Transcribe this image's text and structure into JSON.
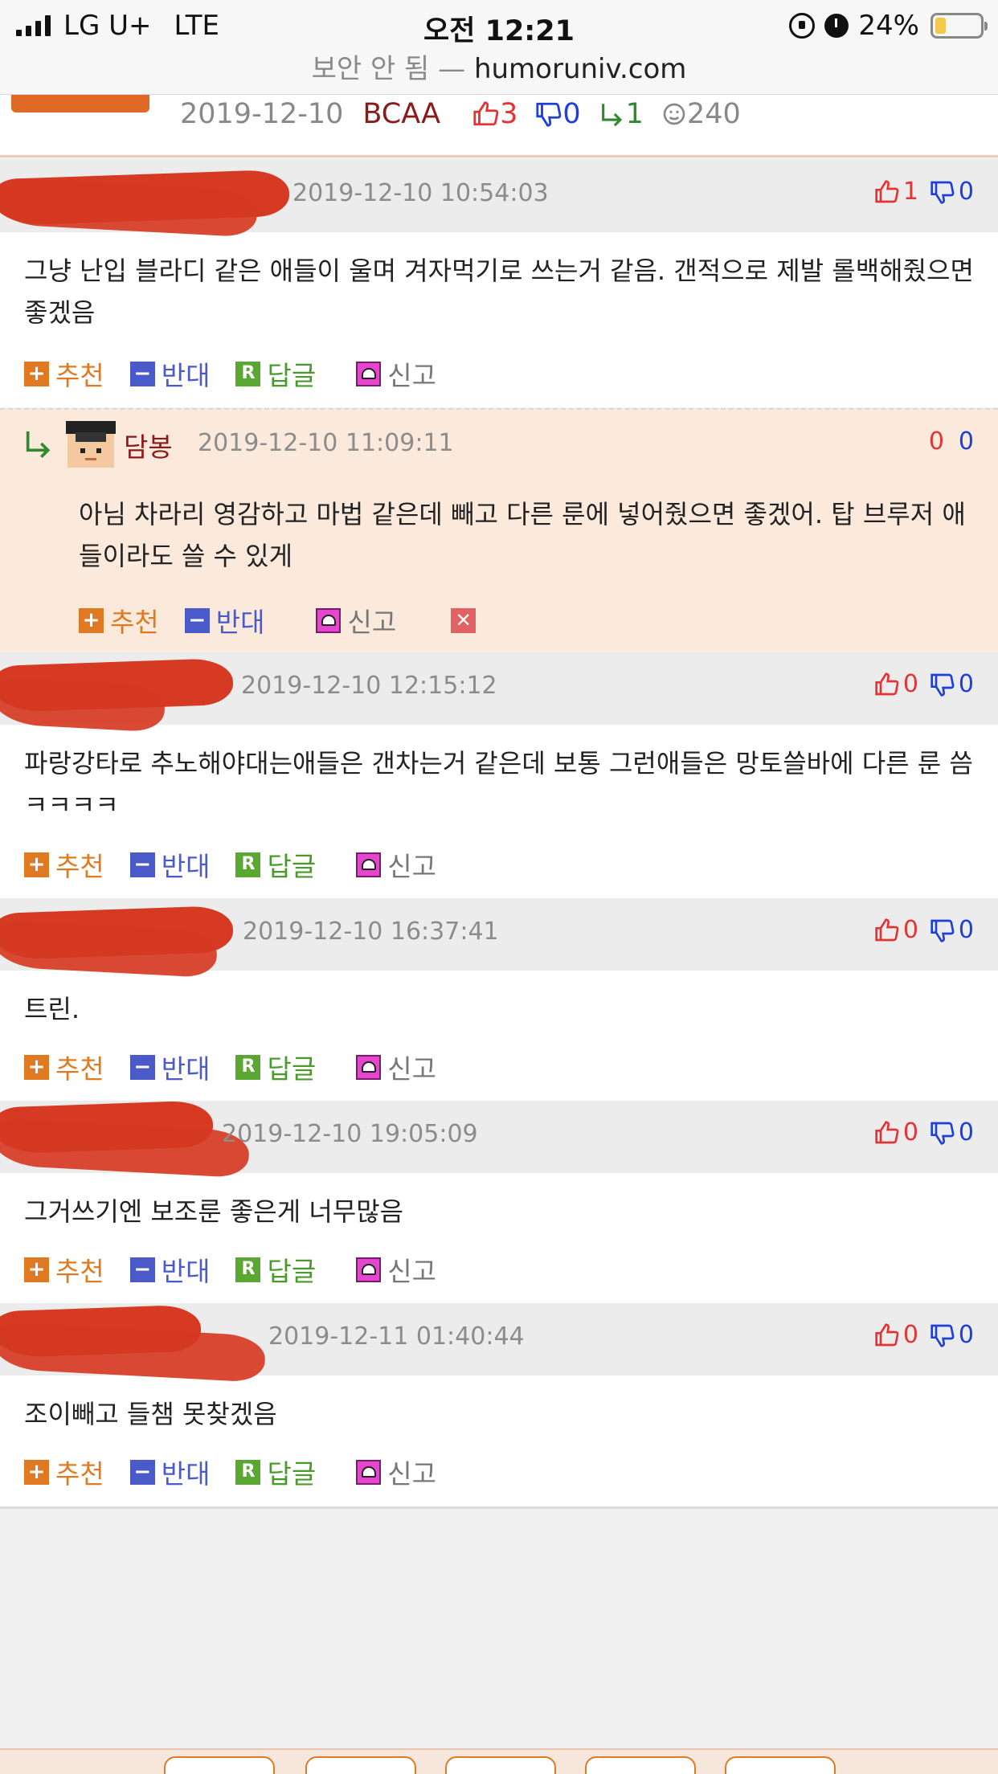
{
  "status_bar": {
    "carrier": "LG U+",
    "network": "LTE",
    "time": "오전 12:21",
    "battery": "24%",
    "battery_level": 0.24
  },
  "url_bar": {
    "warning": "보안 안 됨",
    "separator": " — ",
    "host": "humoruniv.com"
  },
  "post_info": {
    "date": "2019-12-10",
    "nickname": "BCAA",
    "upvotes": "3",
    "downvotes": "0",
    "replies": "1",
    "views": "240"
  },
  "actions": {
    "recommend": "추천",
    "oppose": "반대",
    "reply": "답글",
    "report": "신고"
  },
  "comments": [
    {
      "time": "2019-12-10 10:54:03",
      "up": "1",
      "down": "0",
      "text": "그냥 난입 블라디 같은 애들이 울며 겨자먹기로 쓰는거 같음. 갠적으로 제발 롤백해줬으면 좋겠음"
    },
    {
      "time": "2019-12-10 12:15:12",
      "up": "0",
      "down": "0",
      "text": "파랑강타로 추노해야대는애들은 갠차는거 같은데 보통 그런애들은 망토쓸바에 다른 룬 씀 ㅋㅋㅋㅋ"
    },
    {
      "time": "2019-12-10 16:37:41",
      "up": "0",
      "down": "0",
      "text": "트린."
    },
    {
      "time": "2019-12-10 19:05:09",
      "up": "0",
      "down": "0",
      "text": "그거쓰기엔 보조룬 좋은게 너무많음"
    },
    {
      "time": "2019-12-11 01:40:44",
      "up": "0",
      "down": "0",
      "text": "조이빼고 들챔 못찾겠음"
    }
  ],
  "reply_comment": {
    "nickname": "담봉",
    "time": "2019-12-10 11:09:11",
    "up": "0",
    "down": "0",
    "text": "아님 차라리 영감하고 마법 같은데 빼고 다른 룬에 넣어줬으면 좋겠어. 탑 브루저 애들이라도 쓸 수 있게"
  },
  "icons": {
    "thumb_up": "thumb-up-icon",
    "thumb_down": "thumb-down-icon",
    "reply_arrow": "reply-arrow-icon",
    "views": "smiley-icon"
  },
  "colors": {
    "accent": "#e07a22",
    "up": "#e53333",
    "down": "#1e3fd9",
    "nickname": "#8b1a1a"
  }
}
